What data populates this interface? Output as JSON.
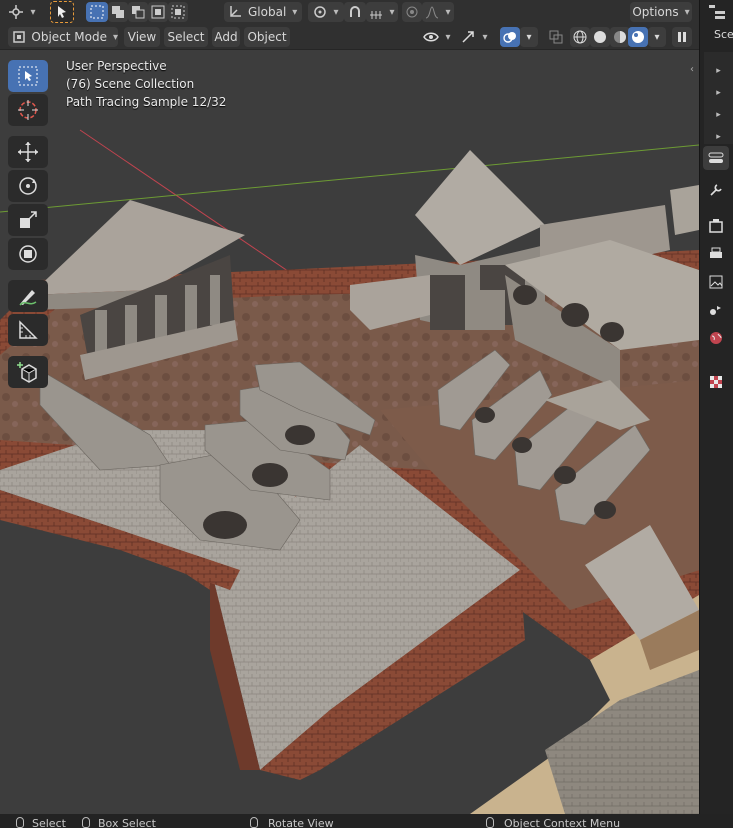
{
  "header": {
    "transform_orientation": "Global",
    "options_label": "Options",
    "mode_label": "Object Mode",
    "menu": [
      "View",
      "Select",
      "Add",
      "Object"
    ],
    "right_tab_label": "Sce"
  },
  "viewport": {
    "perspective": "User Perspective",
    "collection": "(76) Scene Collection",
    "render_status": "Path Tracing Sample 12/32"
  },
  "tools": [
    {
      "name": "select-box",
      "icon": "cursor-box-icon",
      "active": true
    },
    {
      "name": "cursor",
      "icon": "crosshair-icon"
    },
    {
      "name": "move",
      "icon": "move-icon"
    },
    {
      "name": "rotate",
      "icon": "rotate-icon"
    },
    {
      "name": "scale",
      "icon": "scale-icon"
    },
    {
      "name": "transform",
      "icon": "transform-icon"
    },
    {
      "name": "annotate",
      "icon": "pencil-icon"
    },
    {
      "name": "measure",
      "icon": "ruler-icon"
    },
    {
      "name": "add-cube",
      "icon": "cube-add-icon"
    }
  ],
  "status_bar": {
    "items": [
      "Select",
      "Box Select",
      "Rotate View",
      "Object Context Menu"
    ]
  },
  "colors": {
    "accent": "#4772b3",
    "panel": "#303030",
    "viewport_bg": "#3d3d3d",
    "x_axis": "#c0444f",
    "y_axis": "#6d9b34"
  }
}
